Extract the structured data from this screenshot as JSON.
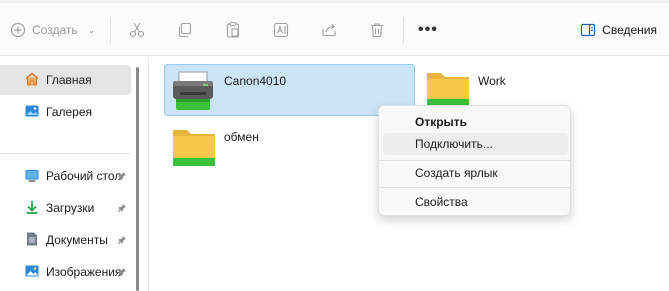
{
  "toolbar": {
    "new_label": "Создать",
    "details_label": "Сведения",
    "more_label": "•••",
    "icons": [
      "plus-circle-icon",
      "scissors-icon",
      "copy-icon",
      "paste-icon",
      "rename-icon",
      "share-icon",
      "trash-icon",
      "details-pane-icon"
    ]
  },
  "sidebar": {
    "items": [
      {
        "label": "Главная",
        "icon": "home-icon",
        "active": true
      },
      {
        "label": "Галерея",
        "icon": "gallery-icon"
      },
      {
        "label": "Рабочий стол",
        "icon": "desktop-icon",
        "pinned": true
      },
      {
        "label": "Загрузки",
        "icon": "download-icon",
        "pinned": true
      },
      {
        "label": "Документы",
        "icon": "documents-icon",
        "pinned": true
      },
      {
        "label": "Изображения",
        "icon": "pictures-icon",
        "pinned": true
      }
    ]
  },
  "content": {
    "items": [
      {
        "label": "Canon4010",
        "type": "printer",
        "selected": true
      },
      {
        "label": "Work",
        "type": "folder"
      },
      {
        "label": "обмен",
        "type": "folder"
      }
    ]
  },
  "context_menu": {
    "items": [
      {
        "label": "Открыть",
        "bold": true
      },
      {
        "label": "Подключить...",
        "hover": true
      },
      {
        "label": "Создать ярлык"
      },
      {
        "label": "Свойства"
      }
    ]
  },
  "colors": {
    "selection_bg": "#cce4f7",
    "selection_border": "#99c9ef",
    "folder_yellow": "#f7c948",
    "shared_green": "#3cc13c",
    "accent_blue": "#0067c0"
  }
}
